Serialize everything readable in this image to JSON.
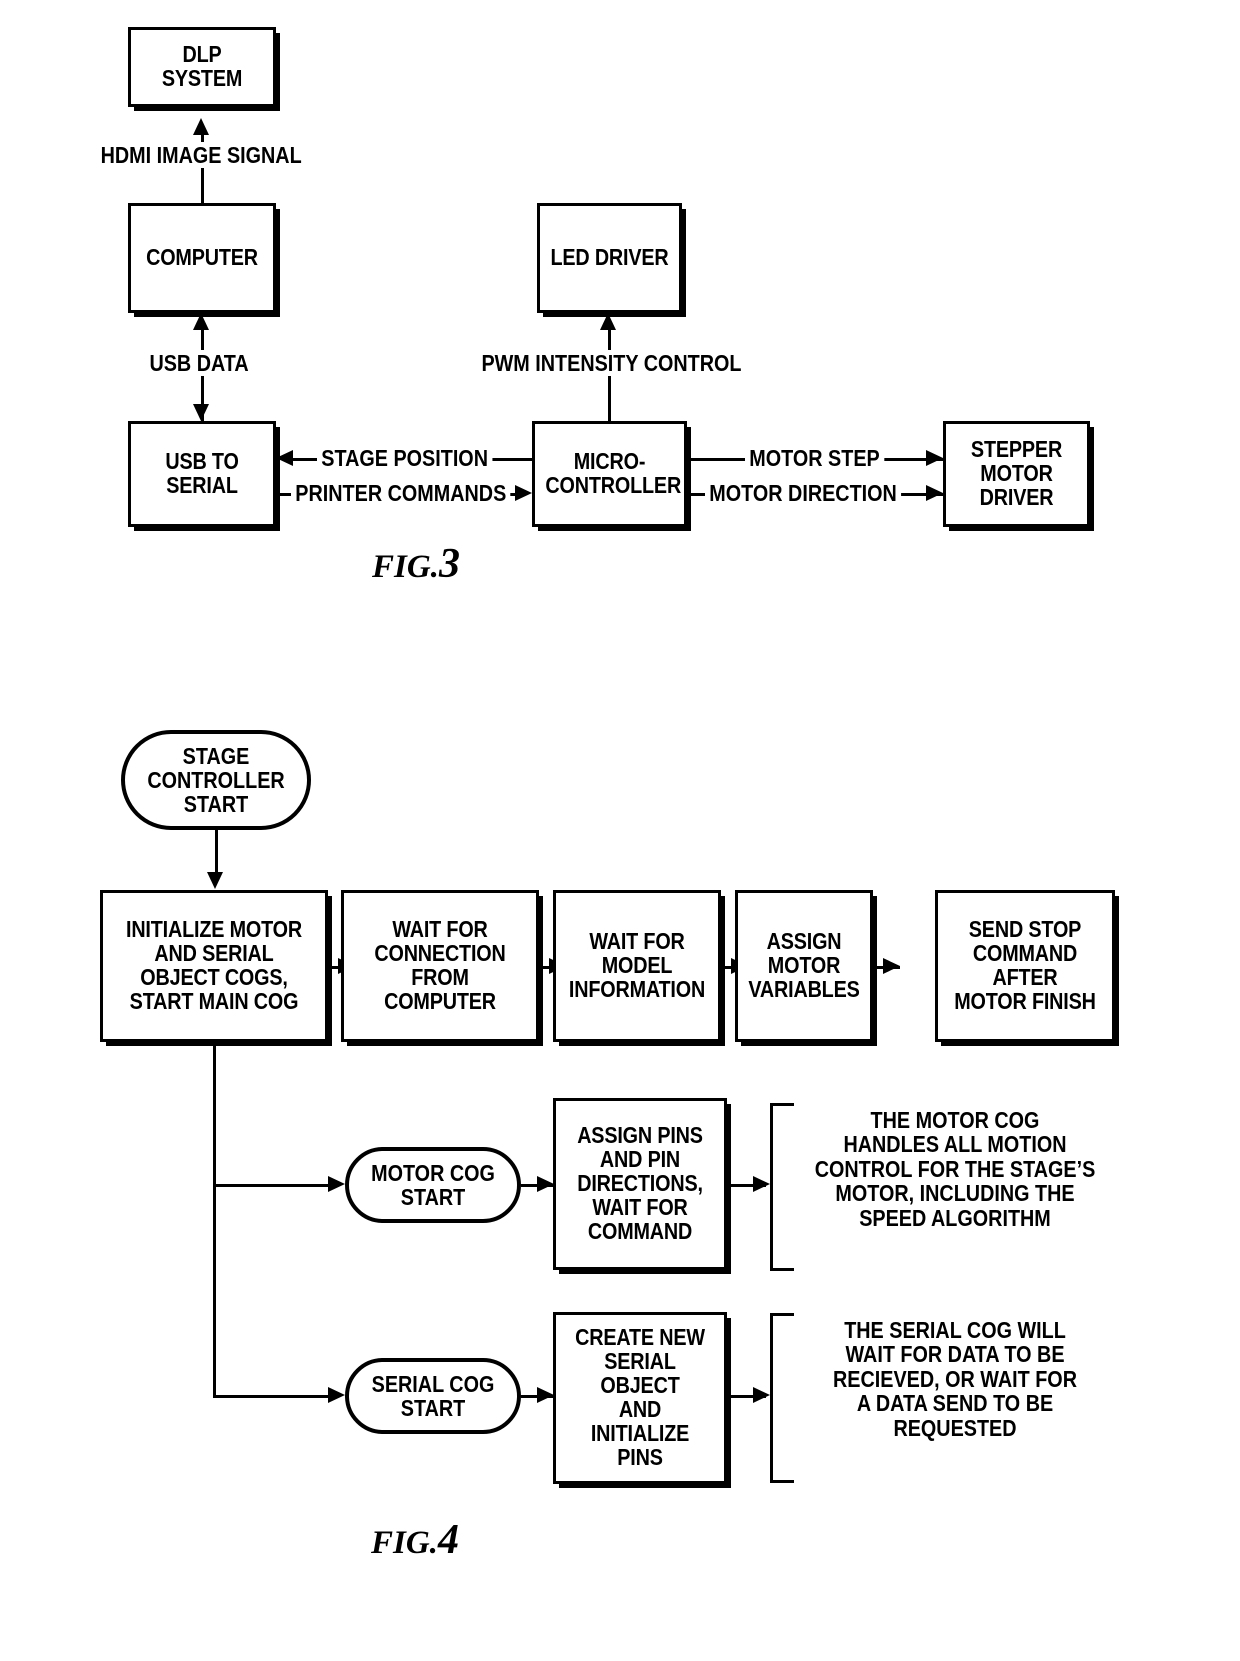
{
  "document": {
    "type": "patent-figure-sheet",
    "figures": [
      "FIG. 3",
      "FIG. 4"
    ]
  },
  "fig3": {
    "caption_prefix": "FIG.",
    "caption_number": "3",
    "blocks": {
      "dlp_system": "DLP SYSTEM",
      "computer": "COMPUTER",
      "led_driver": "LED DRIVER",
      "usb_to_serial": "USB TO\nSERIAL",
      "microcontroller": "MICRO-\nCONTROLLER",
      "stepper_motor_driver": "STEPPER\nMOTOR\nDRIVER"
    },
    "signals": {
      "hdmi": "HDMI IMAGE SIGNAL",
      "usb_data": "USB DATA",
      "pwm": "PWM INTENSITY CONTROL",
      "stage_position": "STAGE POSITION",
      "printer_commands": "PRINTER COMMANDS",
      "motor_step": "MOTOR STEP",
      "motor_direction": "MOTOR DIRECTION"
    }
  },
  "fig4": {
    "caption_prefix": "FIG.",
    "caption_number": "4",
    "terminals": {
      "stage_controller_start": "STAGE\nCONTROLLER\nSTART",
      "motor_cog_start": "MOTOR COG\nSTART",
      "serial_cog_start": "SERIAL COG\nSTART"
    },
    "main_steps": [
      "INITIALIZE MOTOR\nAND SERIAL\nOBJECT COGS,\nSTART MAIN COG",
      "WAIT FOR\nCONNECTION\nFROM COMPUTER",
      "WAIT FOR\nMODEL\nINFORMATION",
      "ASSIGN\nMOTOR\nVARIABLES",
      "SEND STOP\nCOMMAND AFTER\nMOTOR FINISH"
    ],
    "motor_branch": {
      "step": "ASSIGN PINS\nAND PIN\nDIRECTIONS,\nWAIT FOR\nCOMMAND",
      "note": "THE MOTOR COG\nHANDLES ALL MOTION\nCONTROL FOR THE STAGE’S\nMOTOR, INCLUDING THE\nSPEED ALGORITHM"
    },
    "serial_branch": {
      "step": "CREATE NEW\nSERIAL OBJECT\nAND INITIALIZE\nPINS",
      "note": "THE SERIAL COG WILL\nWAIT FOR DATA TO BE\nRECIEVED, OR WAIT FOR\nA DATA SEND TO BE\nREQUESTED"
    }
  },
  "colors": {
    "ink": "#000000",
    "paper": "#ffffff"
  }
}
